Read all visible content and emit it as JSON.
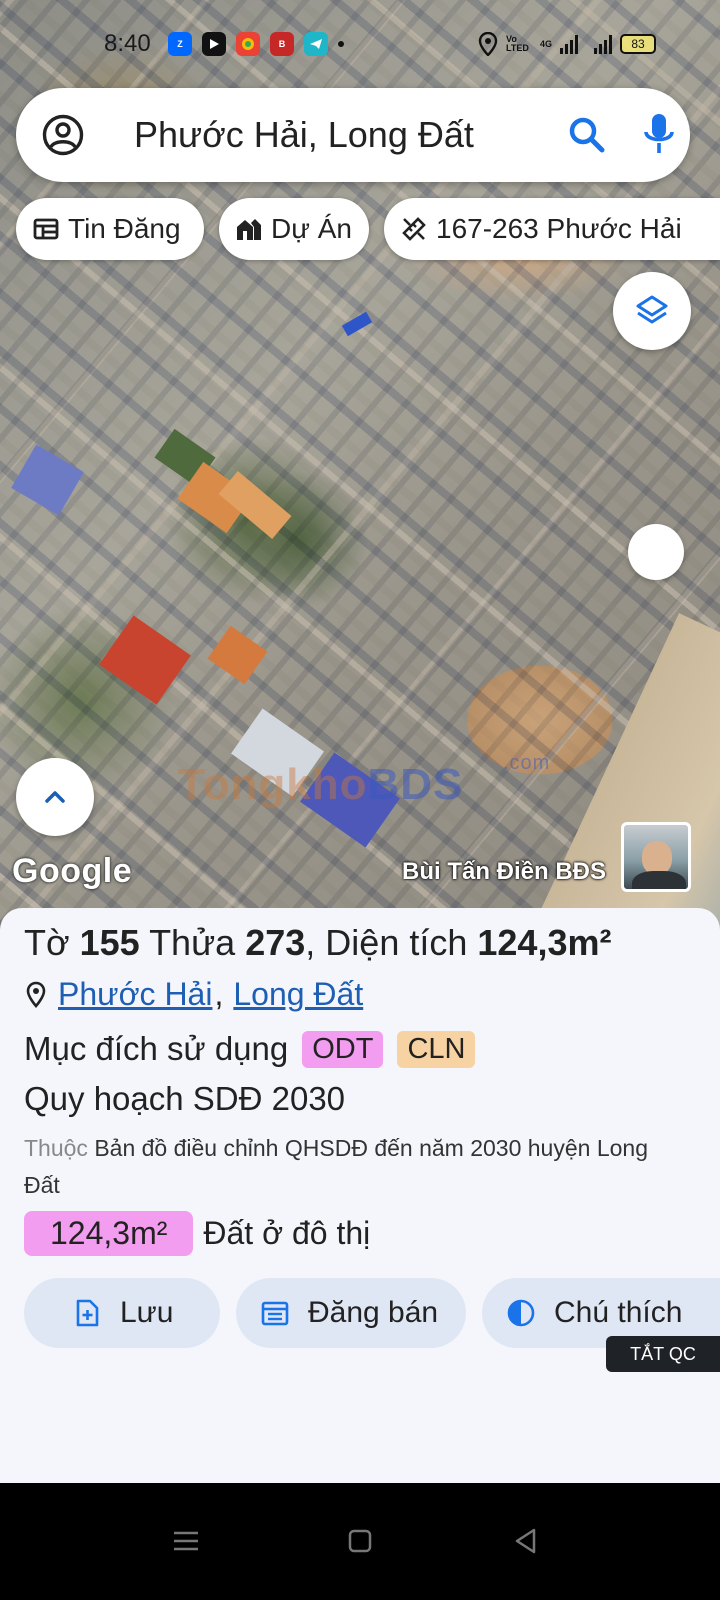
{
  "status_bar": {
    "time": "8:40",
    "apps": [
      "Zalo",
      "YouTube",
      "Photos",
      "Báo Mới",
      "Telegram"
    ],
    "network_label": "Vo LTED",
    "network_type": "4G",
    "battery": "83"
  },
  "search": {
    "value": "Phước Hải, Long Đất",
    "icons": [
      "account-icon",
      "search-icon",
      "mic-icon"
    ]
  },
  "chips": [
    {
      "label": "Tin Đăng",
      "icon": "listing-icon"
    },
    {
      "label": "Dự Án",
      "icon": "project-icon"
    },
    {
      "label": "167-263 Phước Hải",
      "icon": "ruler-icon"
    }
  ],
  "map": {
    "watermark_left": "Tongkho",
    "watermark_right": "BDS",
    "watermark_suffix": ".com",
    "google_label": "Google",
    "author": "Bùi Tấn Điền BĐS"
  },
  "parcel": {
    "sheet_label": "Tờ",
    "sheet_no": "155",
    "lot_label": "Thửa",
    "lot_no": "273",
    "area_label": ", Diện tích",
    "area_value": "124,3m²",
    "ward": "Phước Hải",
    "district": "Long Đất",
    "purpose_label": "Mục đích sử dụng",
    "purpose_tags": [
      "ODT",
      "CLN"
    ],
    "plan_title": "Quy hoạch SDĐ 2030",
    "plan_prefix": "Thuộc",
    "plan_desc": "Bản đồ điều chỉnh QHSDĐ đến năm 2030 huyện Long Đất",
    "zone_area": "124,3m²",
    "zone_type": "Đất ở đô thị"
  },
  "actions": [
    {
      "label": "Lưu",
      "icon": "save-file-icon"
    },
    {
      "label": "Đăng bán",
      "icon": "post-sale-icon"
    },
    {
      "label": "Chú thích",
      "icon": "legend-icon"
    }
  ],
  "ads_off": "TẮT QC",
  "colors": {
    "accent_blue": "#1a73e8",
    "tag_odt": "#f39df0",
    "tag_cln": "#f7d3a3",
    "action_bg": "#dfe6f4",
    "link": "#1f5fb3"
  }
}
